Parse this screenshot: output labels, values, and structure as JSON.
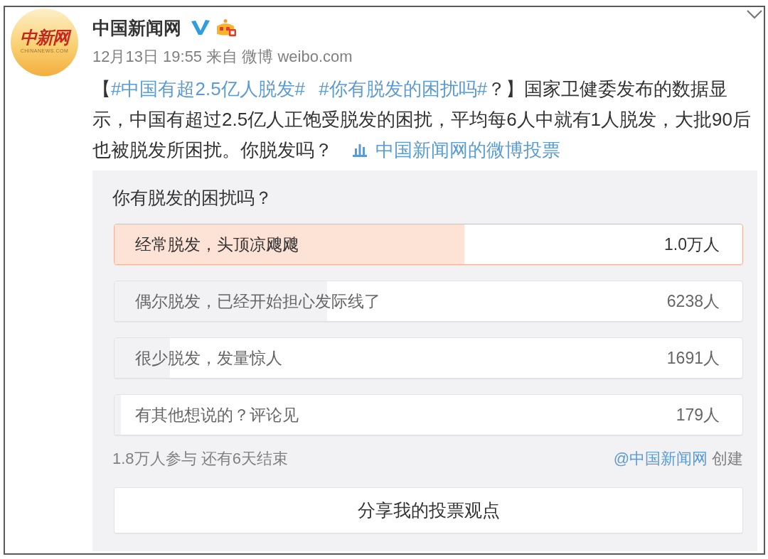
{
  "author": {
    "name": "中国新闻网",
    "verified": true,
    "member_badge": true,
    "avatar": {
      "logo_text": "中新网",
      "logo_subtext": "CHINANEWS.COM"
    }
  },
  "meta": "12月13日 19:55 来自 微博 weibo.com",
  "text": [
    {
      "kind": "text",
      "text": "【"
    },
    {
      "kind": "hashtag",
      "text": "#中国有超2.5亿人脱发#"
    },
    {
      "kind": "hashtag",
      "text": "#你有脱发的困扰吗#"
    },
    {
      "kind": "text",
      "text": "？】国家卫健委发布的数据显示，中国有超过2.5亿人正饱受脱发的困扰，平均每6人中就有1人脱发，大批90后也被脱发所困扰。你脱发吗？"
    },
    {
      "kind": "poll_link",
      "text": "中国新闻网的微博投票"
    }
  ],
  "poll": {
    "question": "你有脱发的困扰吗？",
    "options": [
      {
        "label": "经常脱发，头顶凉飕飕",
        "count": "1.0万人",
        "level": 0.557,
        "selected": true
      },
      {
        "label": "偶尔脱发，已经开始担心发际线了",
        "count": "6238人",
        "level": 0.339,
        "selected": false
      },
      {
        "label": "很少脱发，发量惊人",
        "count": "1691人",
        "level": 0.088,
        "selected": false
      },
      {
        "label": "有其他想说的？评论见",
        "count": "179人",
        "level": 0.01,
        "selected": false
      }
    ],
    "summary": "1.8万人参与 还有6天结束",
    "creator": "@中国新闻网",
    "creator_suffix": "创建",
    "share_button": "分享我的投票观点"
  }
}
